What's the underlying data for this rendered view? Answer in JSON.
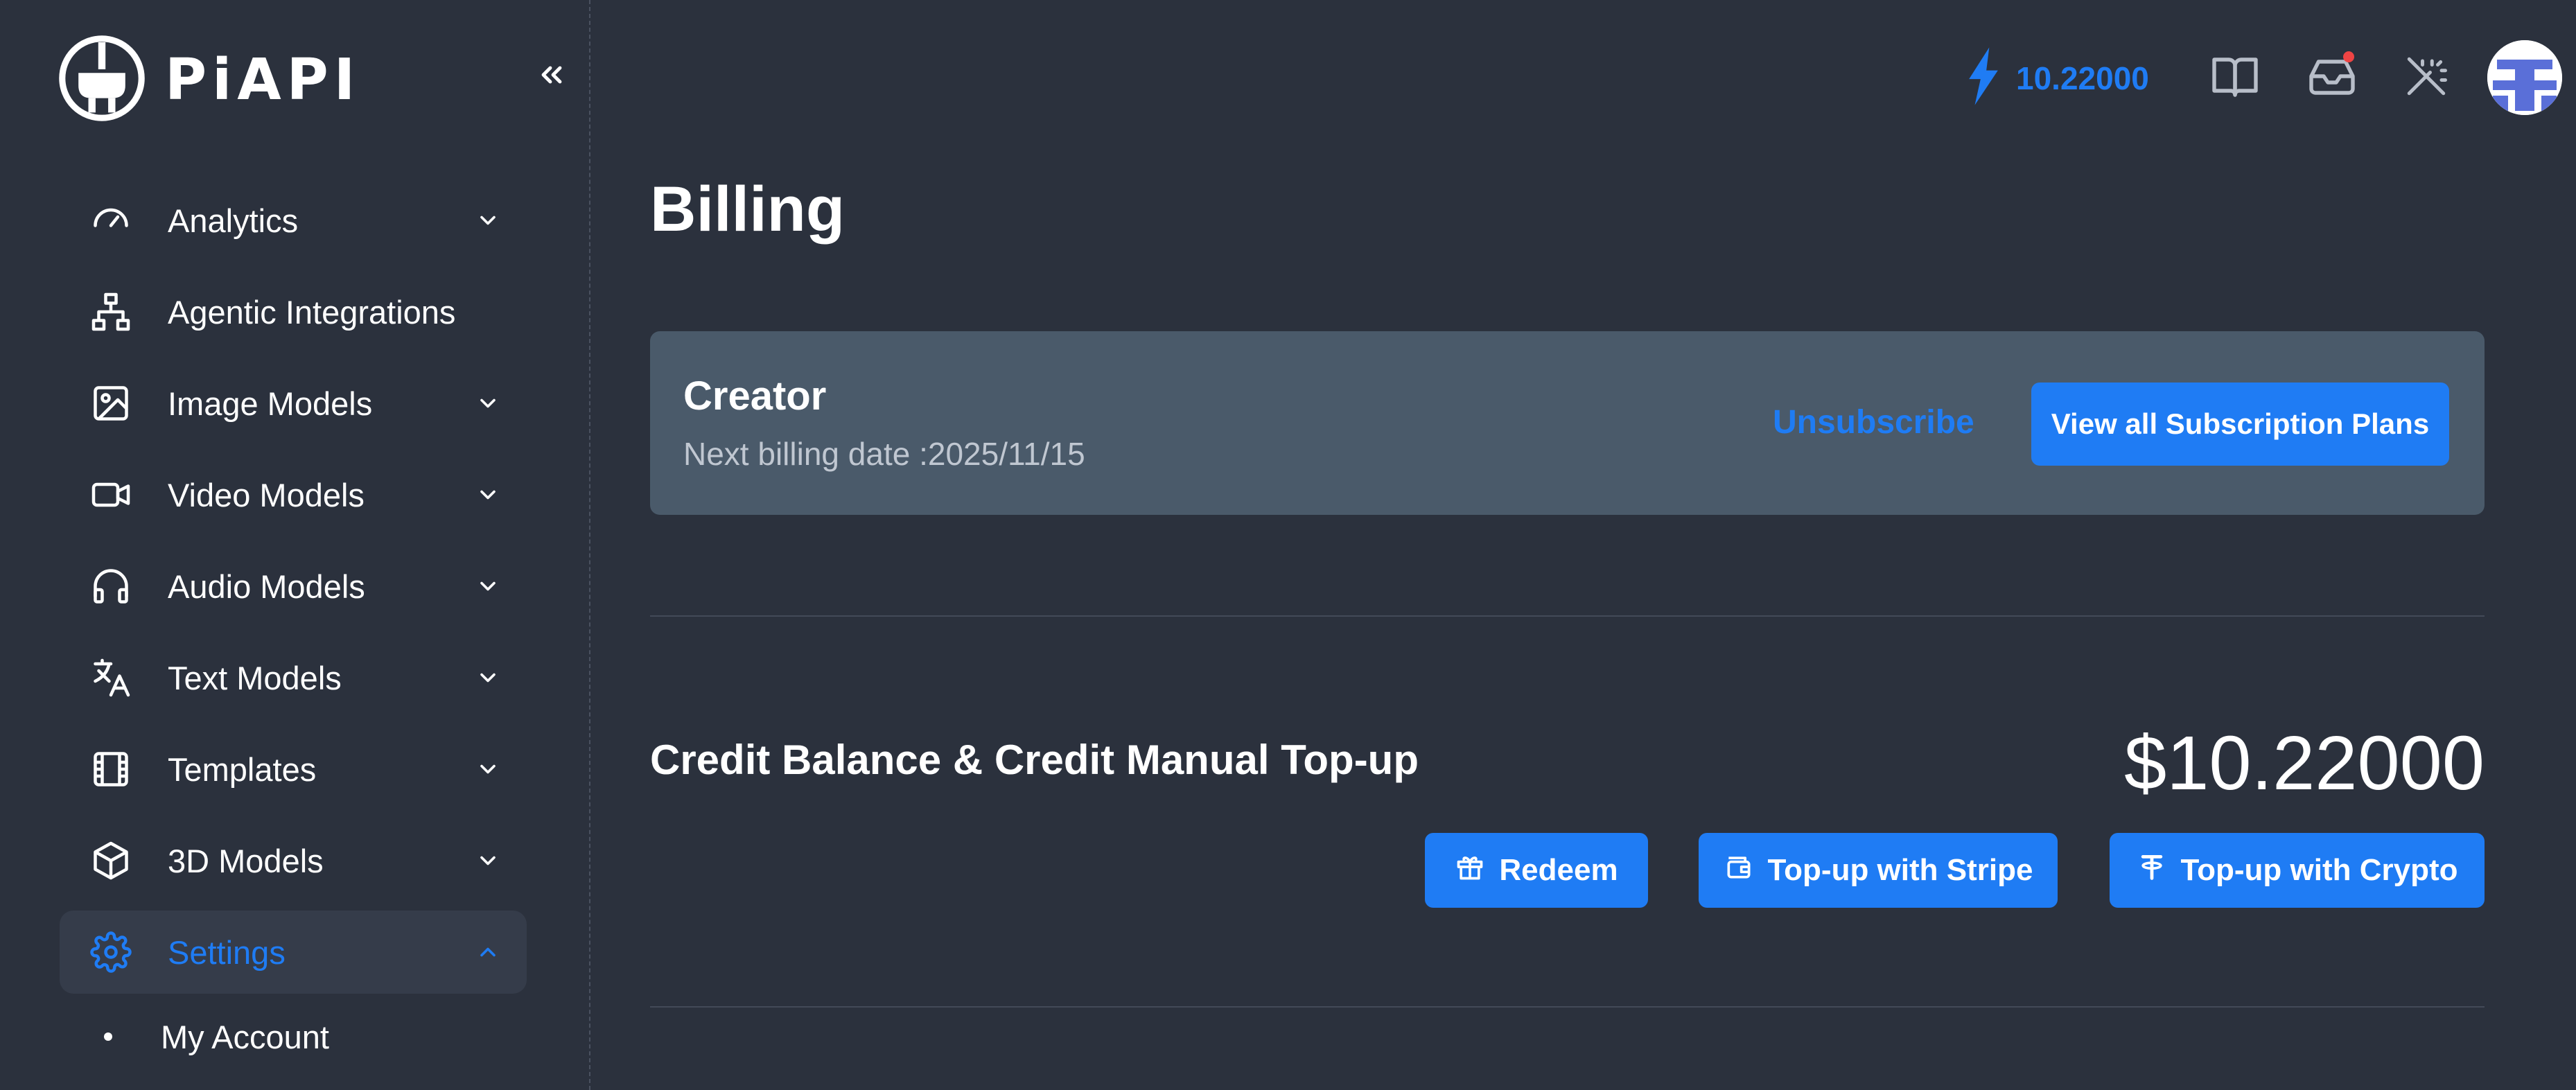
{
  "brand": {
    "logo_text": "PiAPI"
  },
  "sidebar": {
    "items": [
      {
        "label": "Analytics",
        "icon": "gauge-icon",
        "has_chevron": true,
        "expanded": false
      },
      {
        "label": "Agentic Integrations",
        "icon": "sitemap-icon",
        "has_chevron": false
      },
      {
        "label": "Image Models",
        "icon": "image-icon",
        "has_chevron": true,
        "expanded": false
      },
      {
        "label": "Video Models",
        "icon": "video-camera-icon",
        "has_chevron": true,
        "expanded": false
      },
      {
        "label": "Audio Models",
        "icon": "headphones-icon",
        "has_chevron": true,
        "expanded": false
      },
      {
        "label": "Text Models",
        "icon": "translate-icon",
        "has_chevron": true,
        "expanded": false
      },
      {
        "label": "Templates",
        "icon": "film-icon",
        "has_chevron": true,
        "expanded": false
      },
      {
        "label": "3D Models",
        "icon": "cube-icon",
        "has_chevron": true,
        "expanded": false
      },
      {
        "label": "Settings",
        "icon": "gear-icon",
        "has_chevron": true,
        "expanded": true,
        "active": true
      }
    ],
    "sub_items": [
      {
        "label": "My Account"
      }
    ]
  },
  "topbar": {
    "credits_value": "10.22000",
    "icons": [
      "bolt-icon",
      "book-icon",
      "inbox-icon",
      "magic-wand-off-icon",
      "avatar"
    ]
  },
  "main": {
    "title": "Billing",
    "plan": {
      "name": "Creator",
      "next_billing": "Next billing date :2025/11/15",
      "unsubscribe_label": "Unsubscribe",
      "view_plans_label": "View all Subscription Plans"
    },
    "balance": {
      "title": "Credit Balance & Credit Manual Top-up",
      "amount": "$10.22000",
      "redeem_label": "Redeem",
      "stripe_label": "Top-up with Stripe",
      "crypto_label": "Top-up with Crypto"
    }
  },
  "colors": {
    "background": "#2b313d",
    "accent": "#1f7cf4",
    "card": "#4a5a6a",
    "notification": "#ef4444"
  }
}
